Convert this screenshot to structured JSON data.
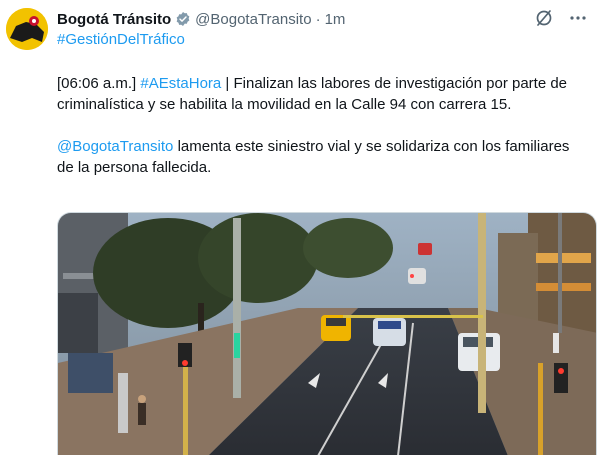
{
  "tweet": {
    "author_name": "Bogotá Tránsito",
    "handle": "@BogotaTransito",
    "separator": "·",
    "time": "1m",
    "hashtag_top": "#GestiónDelTráfico",
    "p1_prefix": "[06:06 a.m.] ",
    "p1_hashtag": "#AEstaHora",
    "p1_rest": " | Finalizan las labores de investigación por parte de criminalística y se habilita la movilidad en la Calle 94 con carrera 15.",
    "p2_mention": "@BogotaTransito",
    "p2_rest_1": " lamenta este siniestro vial y se solidariza con los familiares",
    "p2_rest_2": "de la persona fallecida."
  },
  "icons": {
    "verified": "verified-badge-icon",
    "grok": "grok-slash-icon",
    "more": "more-options-icon"
  },
  "colors": {
    "link": "#1d9bf0",
    "text": "#0f1419",
    "muted": "#536471",
    "avatar_bg": "#f2c200"
  }
}
